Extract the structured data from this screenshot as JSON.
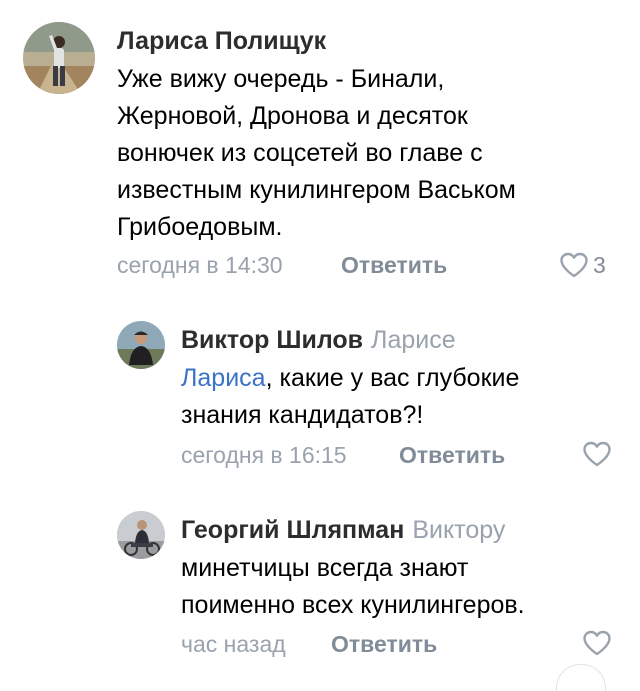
{
  "comments": [
    {
      "author": "Лариса Полищук",
      "reply_to": "",
      "mention": "",
      "text_lines": [
        "Уже вижу очередь - Бинали,",
        "Жерновой, Дронова и десяток",
        "вонючек из соцсетей во главе с",
        "известным кунилингером Васьком",
        "Грибоедовым."
      ],
      "time": "сегодня в 14:30",
      "reply_label": "Ответить",
      "likes": "3",
      "avatar_icon": "woman-standing-outdoors-photo"
    },
    {
      "author": "Виктор Шилов",
      "reply_to": "Ларисе",
      "mention": "Лариса",
      "text_line1_rest": ", какие у вас глубокие",
      "text_line2": "знания кандидатов?!",
      "time": "сегодня в 16:15",
      "reply_label": "Ответить",
      "likes": "",
      "avatar_icon": "man-with-cap-photo"
    },
    {
      "author": "Георгий Шляпман",
      "reply_to": "Виктору",
      "mention": "",
      "text_lines": [
        "минетчицы всегда знают",
        "поименно всех кунилингеров."
      ],
      "time": "час назад",
      "reply_label": "Ответить",
      "likes": "",
      "avatar_icon": "man-on-motorcycle-photo"
    }
  ],
  "colors": {
    "name": "#2c2d2e",
    "secondary": "#99a2ad",
    "reply": "#818c99",
    "mention": "#3b73c4"
  }
}
